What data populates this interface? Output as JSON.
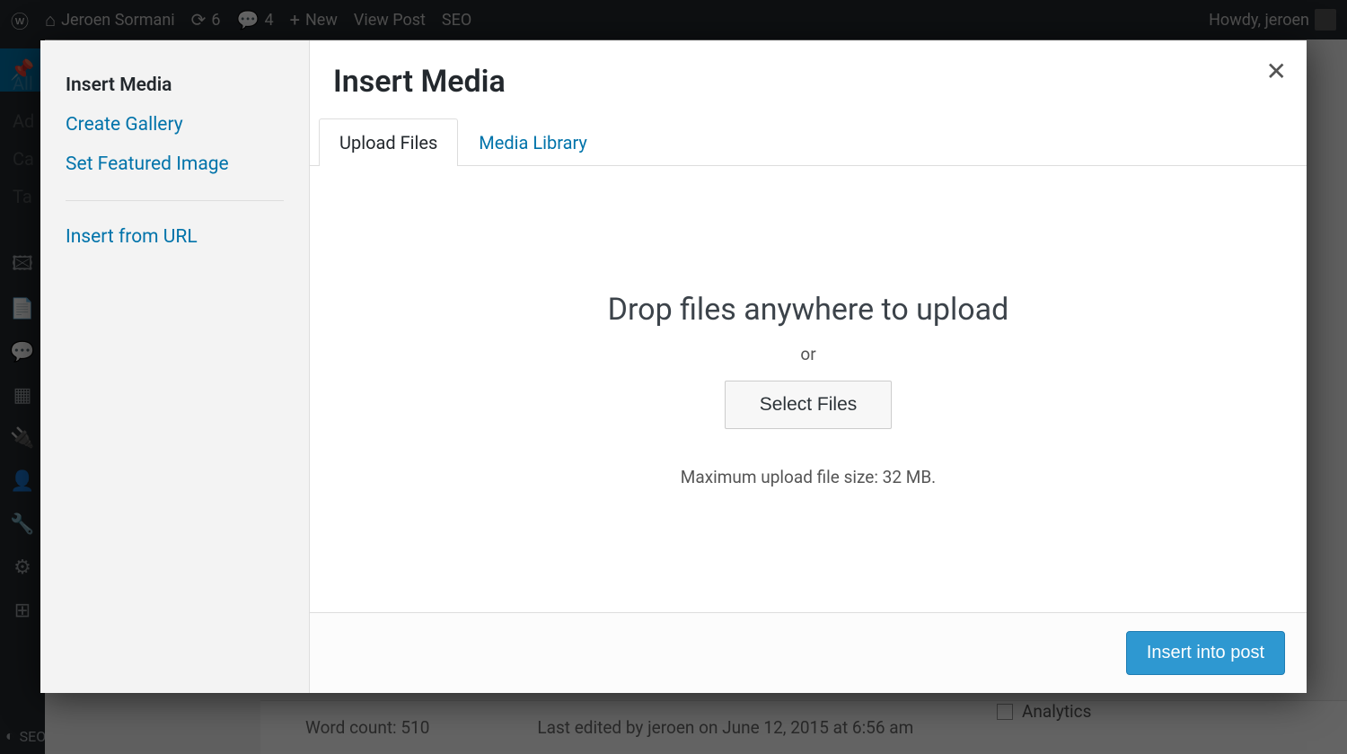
{
  "adminbar": {
    "site_name": "Jeroen Sormani",
    "updates_count": "6",
    "comments_count": "4",
    "new_label": "New",
    "view_post": "View Post",
    "seo": "SEO",
    "howdy": "Howdy, jeroen"
  },
  "bg_submenu": {
    "items": [
      "All",
      "Ad",
      "Ca",
      "Ta"
    ]
  },
  "bg_footer": {
    "word_count": "Word count: 510",
    "last_edited": "Last edited by jeroen on June 12, 2015 at 6:56 am"
  },
  "bg_tags": {
    "items": [
      "Analytics"
    ]
  },
  "admin_menu_last": "SEO",
  "modal": {
    "title": "Insert Media",
    "sidebar": {
      "insert_media": "Insert Media",
      "create_gallery": "Create Gallery",
      "set_featured": "Set Featured Image",
      "insert_url": "Insert from URL"
    },
    "tabs": {
      "upload": "Upload Files",
      "library": "Media Library"
    },
    "upload": {
      "headline": "Drop files anywhere to upload",
      "or": "or",
      "select_btn": "Select Files",
      "max_note": "Maximum upload file size: 32 MB."
    },
    "footer": {
      "insert_btn": "Insert into post"
    }
  }
}
